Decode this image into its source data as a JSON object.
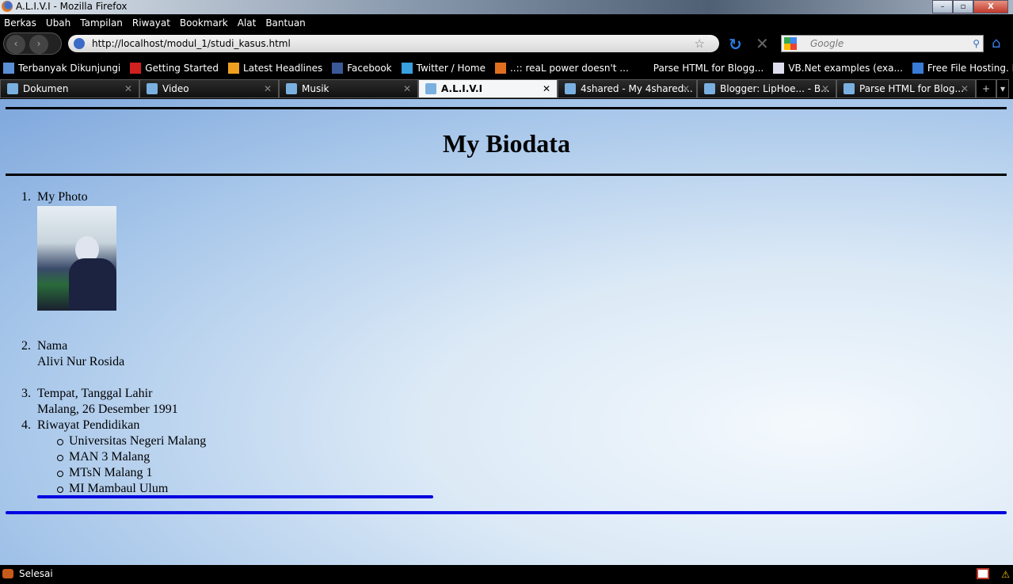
{
  "window": {
    "title": "A.L.I.V.I - Mozilla Firefox",
    "minimize": "–",
    "maximize": "▫",
    "close": "X"
  },
  "menu": [
    "Berkas",
    "Ubah",
    "Tampilan",
    "Riwayat",
    "Bookmark",
    "Alat",
    "Bantuan"
  ],
  "nav": {
    "url": "http://localhost/modul_1/studi_kasus.html",
    "search_placeholder": "Google"
  },
  "bookmarks": [
    {
      "label": "Terbanyak Dikunjungi",
      "icon": "search-icon",
      "color": "#5b8fd6"
    },
    {
      "label": "Getting Started",
      "icon": "firefox-icon",
      "color": "#d02020"
    },
    {
      "label": "Latest Headlines",
      "icon": "rss-icon",
      "color": "#f0a020"
    },
    {
      "label": "Facebook",
      "icon": "facebook-icon",
      "color": "#3b5998"
    },
    {
      "label": "Twitter / Home",
      "icon": "twitter-icon",
      "color": "#3aa0e0"
    },
    {
      "label": "..:: reaL power doesn't ...",
      "icon": "page-icon",
      "color": "#e07020"
    },
    {
      "label": "Parse HTML for Blogg...",
      "icon": "",
      "color": ""
    },
    {
      "label": "VB.Net examples (exa...",
      "icon": "page-icon",
      "color": "#dde"
    },
    {
      "label": "Free File Hosting. File ...",
      "icon": "4shared-icon",
      "color": "#3a7bd5"
    }
  ],
  "tabs": [
    {
      "label": "Dokumen",
      "active": false
    },
    {
      "label": "Video",
      "active": false
    },
    {
      "label": "Musik",
      "active": false
    },
    {
      "label": "A.L.I.V.I",
      "active": true
    },
    {
      "label": "4shared - My 4shared...",
      "active": false
    },
    {
      "label": "Blogger: LipHoe... - B...",
      "active": false
    },
    {
      "label": "Parse HTML for Blog...",
      "active": false
    }
  ],
  "page": {
    "title": "My Biodata",
    "items": [
      {
        "num": "1.",
        "label": "My Photo"
      },
      {
        "num": "2.",
        "label": "Nama",
        "value": "Alivi Nur Rosida"
      },
      {
        "num": "3.",
        "label": "Tempat, Tanggal Lahir",
        "value": "Malang, 26 Desember 1991"
      },
      {
        "num": "4.",
        "label": "Riwayat Pendidikan",
        "sub": [
          "Universitas Negeri Malang",
          "MAN 3 Malang",
          "MTsN Malang 1",
          "MI Mambaul Ulum"
        ]
      }
    ]
  },
  "status": {
    "text": "Selesai"
  }
}
